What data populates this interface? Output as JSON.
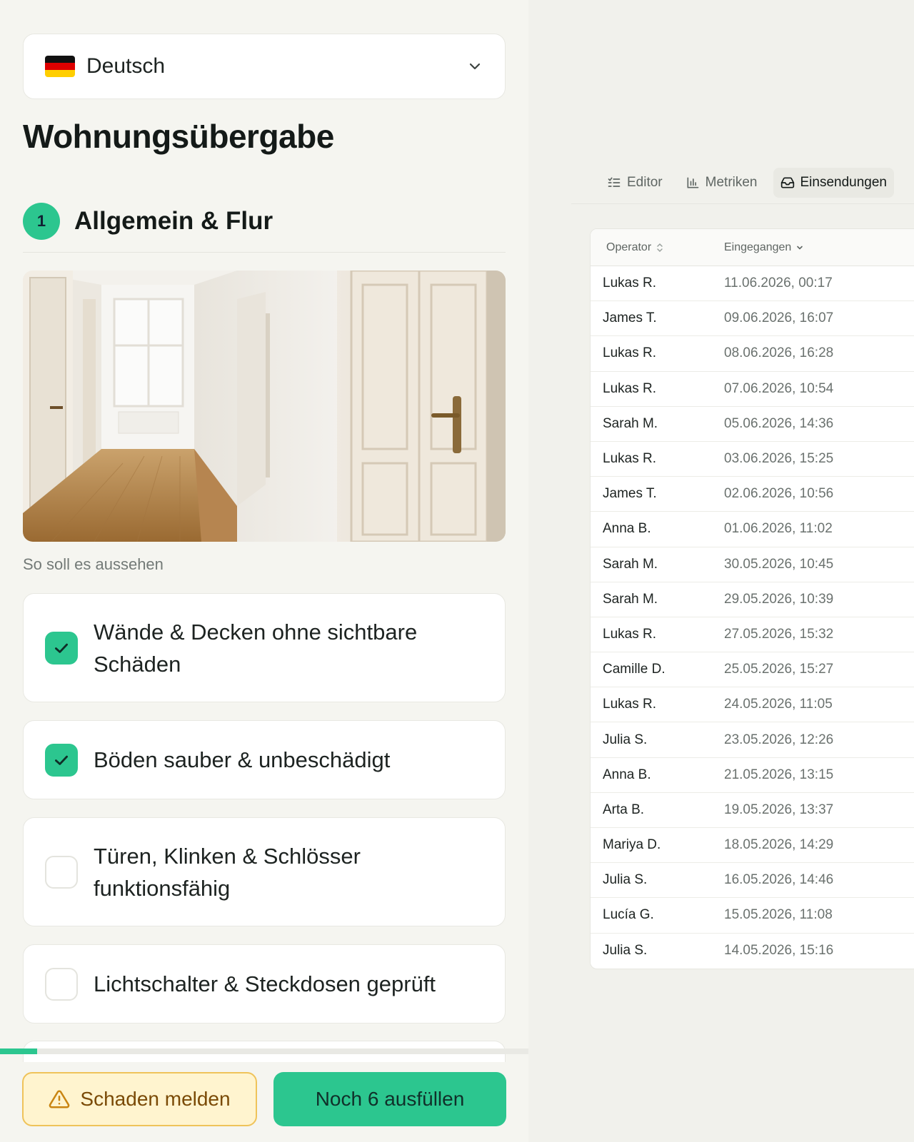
{
  "language": {
    "selected": "Deutsch"
  },
  "form": {
    "title": "Wohnungsübergabe",
    "section": {
      "number": "1",
      "title": "Allgemein & Flur"
    },
    "photo_caption": "So soll es aussehen",
    "checklist": [
      {
        "label": "Wände & Decken ohne sichtbare Schäden",
        "checked": true
      },
      {
        "label": "Böden sauber & unbeschädigt",
        "checked": true
      },
      {
        "label": "Türen, Klinken & Schlösser funktionsfähig",
        "checked": false
      },
      {
        "label": "Lichtschalter & Steckdosen geprüft",
        "checked": false
      }
    ],
    "progress_fraction": 0.07
  },
  "actions": {
    "damage_label": "Schaden melden",
    "fill_label": "Noch 6 ausfüllen"
  },
  "tabs": [
    {
      "label": "Editor",
      "icon": "list-check-icon"
    },
    {
      "label": "Metriken",
      "icon": "bar-chart-icon"
    },
    {
      "label": "Einsendungen",
      "icon": "inbox-icon",
      "active": true
    }
  ],
  "submissions": {
    "columns": [
      "Operator",
      "Eingegangen"
    ],
    "rows": [
      {
        "operator": "Lukas R.",
        "received": "11.06.2026, 00:17"
      },
      {
        "operator": "James T.",
        "received": "09.06.2026, 16:07"
      },
      {
        "operator": "Lukas R.",
        "received": "08.06.2026, 16:28"
      },
      {
        "operator": "Lukas R.",
        "received": "07.06.2026, 10:54"
      },
      {
        "operator": "Sarah M.",
        "received": "05.06.2026, 14:36"
      },
      {
        "operator": "Lukas R.",
        "received": "03.06.2026, 15:25"
      },
      {
        "operator": "James T.",
        "received": "02.06.2026, 10:56"
      },
      {
        "operator": "Anna B.",
        "received": "01.06.2026, 11:02"
      },
      {
        "operator": "Sarah M.",
        "received": "30.05.2026, 10:45"
      },
      {
        "operator": "Sarah M.",
        "received": "29.05.2026, 10:39"
      },
      {
        "operator": "Lukas R.",
        "received": "27.05.2026, 15:32"
      },
      {
        "operator": "Camille D.",
        "received": "25.05.2026, 15:27"
      },
      {
        "operator": "Lukas R.",
        "received": "24.05.2026, 11:05"
      },
      {
        "operator": "Julia S.",
        "received": "23.05.2026, 12:26"
      },
      {
        "operator": "Anna B.",
        "received": "21.05.2026, 13:15"
      },
      {
        "operator": "Arta B.",
        "received": "19.05.2026, 13:37"
      },
      {
        "operator": "Mariya D.",
        "received": "18.05.2026, 14:29"
      },
      {
        "operator": "Julia S.",
        "received": "16.05.2026, 14:46"
      },
      {
        "operator": "Lucía G.",
        "received": "15.05.2026, 11:08"
      },
      {
        "operator": "Julia S.",
        "received": "14.05.2026, 15:16"
      }
    ]
  },
  "colors": {
    "accent": "#2cc68f",
    "warning_bg": "#fff4cf",
    "warning_border": "#efc35a"
  }
}
